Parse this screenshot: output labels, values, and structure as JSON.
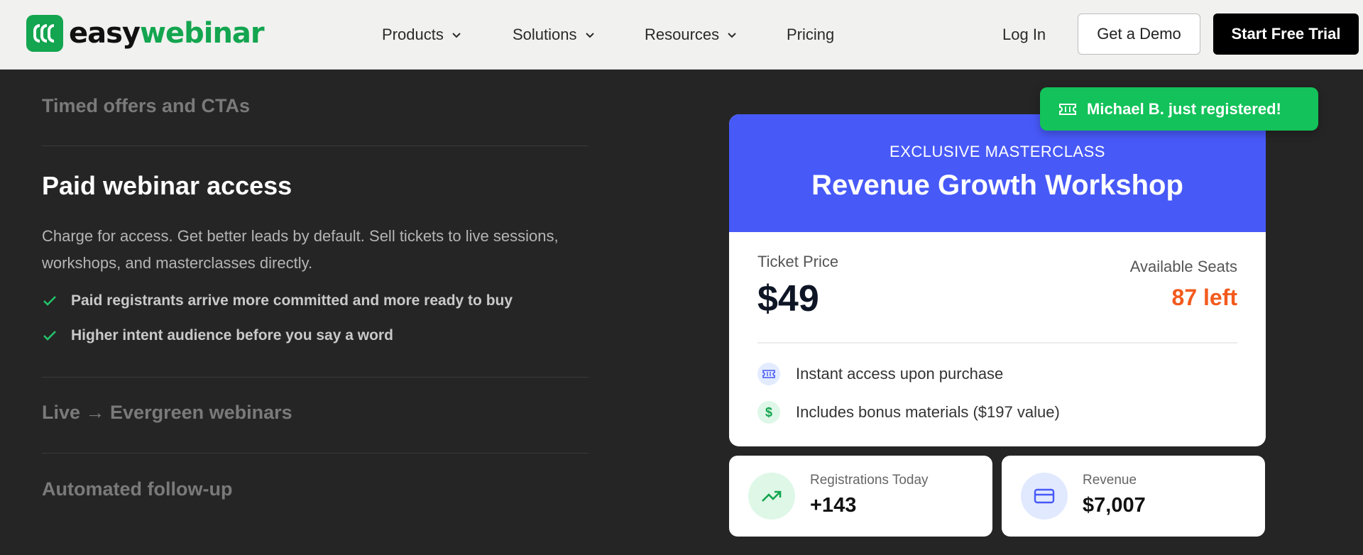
{
  "brand": {
    "name_part1": "easy",
    "name_part2": "webinar"
  },
  "nav": {
    "items": [
      {
        "label": "Products"
      },
      {
        "label": "Solutions"
      },
      {
        "label": "Resources"
      },
      {
        "label": "Pricing"
      }
    ],
    "login": "Log In",
    "demo": "Get a Demo",
    "trial": "Start Free Trial"
  },
  "features": {
    "timed_offers": "Timed offers and CTAs",
    "paid_title": "Paid webinar access",
    "paid_desc": "Charge for access. Get better leads by default. Sell tickets to live sessions, workshops, and masterclasses directly.",
    "paid_points": [
      "Paid registrants arrive more committed and more ready to buy",
      "Higher intent audience before you say a word"
    ],
    "live_evergreen": "Live → Evergreen webinars",
    "follow_up": "Automated follow-up"
  },
  "toast": {
    "text": "Michael B. just registered!"
  },
  "ticket": {
    "kicker": "EXCLUSIVE MASTERCLASS",
    "title": "Revenue Growth Workshop",
    "price_label": "Ticket Price",
    "price": "$49",
    "seats_label": "Available Seats",
    "seats": "87 left",
    "perks": [
      "Instant access upon purchase",
      "Includes bonus materials ($197 value)"
    ]
  },
  "stats": {
    "registrations": {
      "label": "Registrations Today",
      "value": "+143"
    },
    "revenue": {
      "label": "Revenue",
      "value": "$7,007"
    }
  },
  "colors": {
    "brand_green": "#13a54f",
    "toast_green": "#13c25a",
    "card_blue": "#4759f7",
    "seats_orange": "#f35a1e"
  }
}
